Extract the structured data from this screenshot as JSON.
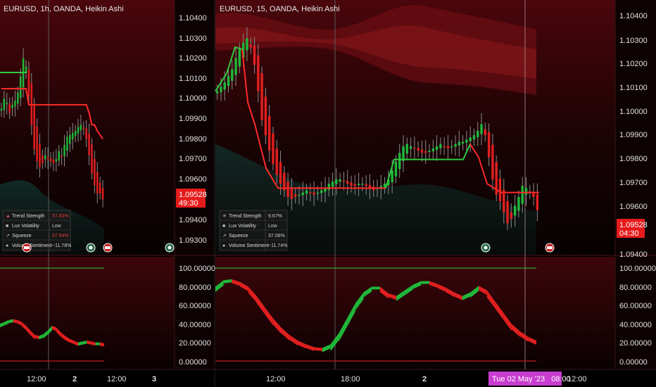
{
  "left_chart": {
    "title": "EURUSD, 1h, OANDA, Heikin Ashi",
    "price_ticks": [
      "1.10400",
      "1.10300",
      "1.10200",
      "1.10100",
      "1.10000",
      "1.09900",
      "1.09800",
      "1.09700",
      "1.09600",
      "1.09400",
      "1.09300"
    ],
    "price_tag": "1.09528",
    "countdown": "49:30",
    "osc_ticks": [
      "100.00000",
      "80.00000",
      "60.00000",
      "40.00000",
      "20.00000",
      "0.00000"
    ],
    "time_labels": [
      "12:00",
      "2",
      "12:00",
      "3"
    ],
    "dashboard": [
      {
        "label": "Trend Strength",
        "value": "57.83%"
      },
      {
        "label": "Lux Volatility",
        "value": "Low"
      },
      {
        "label": "Squeeze",
        "value": "57.94%"
      },
      {
        "label": "Volume Sentiment",
        "value": "~11.78%"
      }
    ]
  },
  "right_chart": {
    "title": "EURUSD, 15, OANDA, Heikin Ashi",
    "price_ticks": [
      "1.10400",
      "1.10300",
      "1.10200",
      "1.10100",
      "1.10000",
      "1.09900",
      "1.09800",
      "1.09700",
      "1.09600",
      "1.09400"
    ],
    "price_tag": "1.09528",
    "countdown": "04:30",
    "osc_ticks": [
      "100.00000",
      "80.00000",
      "60.00000",
      "40.00000",
      "20.00000",
      "0.00000"
    ],
    "time_labels": [
      "12:00",
      "18:00",
      "2",
      "12:00"
    ],
    "crosshair_time": "Tue 02 May '23   08:00",
    "dashboard": [
      {
        "label": "Trend Strength",
        "value": "9.67%"
      },
      {
        "label": "Lux Volatility",
        "value": "Low"
      },
      {
        "label": "Squeeze",
        "value": "37.06%"
      },
      {
        "label": "Volume Sentiment",
        "value": "~11.74%"
      }
    ]
  },
  "colors": {
    "up": "#1fb83a",
    "down": "#e01f1f",
    "trail": "#ff2a2a",
    "trail_up": "#2ecc40",
    "tag": "#e51b1b",
    "crosshair_label": "#c83ccf"
  },
  "chart_data": [
    {
      "type": "candlestick",
      "title": "EURUSD, 1h, OANDA, Heikin Ashi",
      "ylim": [
        1.0928,
        1.1045
      ],
      "close": [
        1.0998,
        1.1003,
        1.1001,
        1.0996,
        1.1,
        1.1002,
        1.1006,
        1.1014,
        1.1023,
        1.1019,
        1.1004,
        1.099,
        1.0978,
        1.0972,
        1.0969,
        1.0971,
        1.0975,
        1.0973,
        1.0972,
        1.0971,
        1.0973,
        1.0977,
        1.0974,
        1.098,
        1.0984,
        1.0985,
        1.0986,
        1.0987,
        1.0989,
        1.099,
        1.0988,
        1.0983,
        1.0975,
        1.0966,
        1.096,
        1.0956,
        1.0956,
        1.0953
      ],
      "trail": [
        1.1008,
        1.1008,
        1.1008,
        1.1008,
        1.1008,
        1.1008,
        1.1008,
        1.1008,
        1.1008,
        1.1008,
        1.1,
        1.1,
        1.1,
        1.1,
        1.1,
        1.1,
        1.1,
        1.1,
        1.1,
        1.1,
        1.1,
        1.1,
        1.1,
        1.1,
        1.1,
        1.1,
        1.1,
        1.1,
        1.1,
        1.1,
        1.1,
        1.1,
        1.0996,
        1.099,
        1.099,
        1.0987,
        1.0985,
        1.0983
      ],
      "oscillator": [
        40,
        42,
        44,
        45,
        44,
        42,
        38,
        33,
        28,
        27,
        29,
        33,
        38,
        36,
        31,
        27,
        24,
        22,
        20,
        21,
        22,
        21,
        20,
        20,
        19
      ]
    },
    {
      "type": "candlestick",
      "title": "EURUSD, 15, OANDA, Heikin Ashi",
      "ylim": [
        1.0938,
        1.1045
      ],
      "close": [
        1.101,
        1.1012,
        1.1014,
        1.1017,
        1.102,
        1.1025,
        1.1029,
        1.1032,
        1.1034,
        1.103,
        1.1022,
        1.101,
        1.0997,
        1.099,
        1.0983,
        1.0977,
        1.0972,
        1.0968,
        1.0965,
        1.0962,
        1.0961,
        1.0962,
        1.0963,
        1.0964,
        1.0965,
        1.0964,
        1.0963,
        1.0964,
        1.0965,
        1.0966,
        1.0968,
        1.0969,
        1.097,
        1.097,
        1.0969,
        1.0968,
        1.0967,
        1.0967,
        1.0968,
        1.0968,
        1.0967,
        1.0966,
        1.0965,
        1.0966,
        1.0967,
        1.0968,
        1.097,
        1.0974,
        1.0978,
        1.0982,
        1.0985,
        1.0986,
        1.0985,
        1.0984,
        1.0983,
        1.0982,
        1.0982,
        1.0983,
        1.0984,
        1.0985,
        1.0986,
        1.0985,
        1.0984,
        1.0985,
        1.0986,
        1.0987,
        1.0987,
        1.0988,
        1.0989,
        1.099,
        1.0992,
        1.0995,
        1.099,
        1.098,
        1.097,
        1.0963,
        1.096,
        1.0955,
        1.095,
        1.0952,
        1.0958,
        1.0962,
        1.0967,
        1.0966,
        1.0964,
        1.0962,
        1.0956
      ],
      "trail_value": 1.0966,
      "oscillator": [
        80,
        87,
        88,
        85,
        80,
        70,
        58,
        46,
        36,
        28,
        22,
        18,
        15,
        14,
        18,
        30,
        46,
        62,
        74,
        80,
        80,
        73,
        70,
        76,
        82,
        86,
        86,
        83,
        79,
        74,
        70,
        74,
        81,
        76,
        64,
        52,
        40,
        32,
        26,
        22
      ]
    }
  ]
}
